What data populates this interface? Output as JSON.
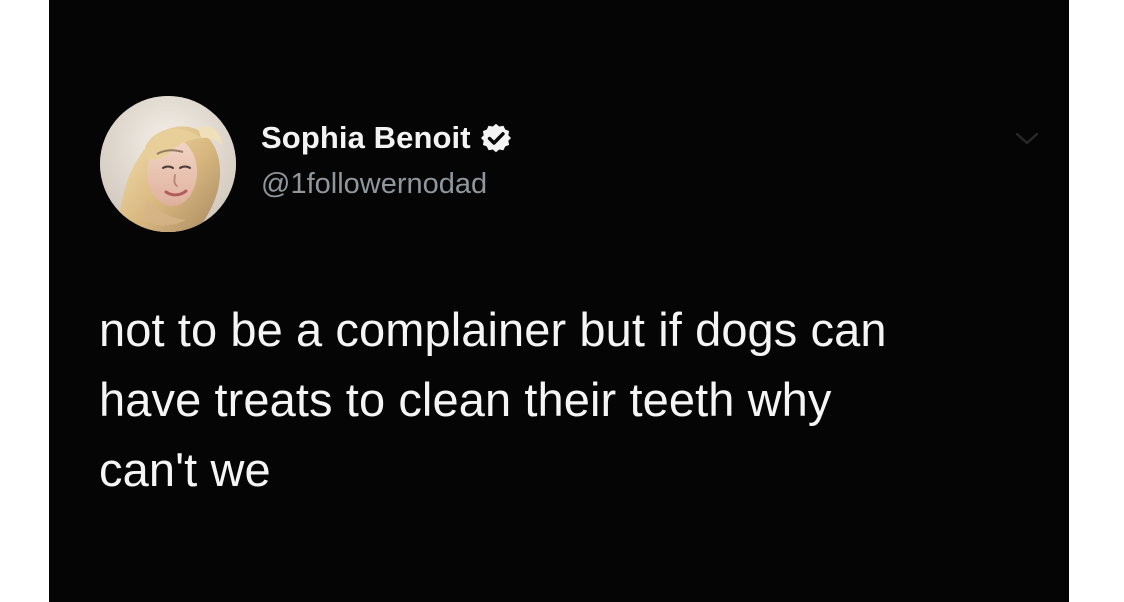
{
  "tweet": {
    "author": {
      "display_name": "Sophia Benoit",
      "handle": "@1followernodad"
    },
    "text_lines": [
      "not to be a complainer but if dogs can",
      "have treats to clean their teeth why",
      "can't we"
    ],
    "icons": {
      "verified": "verified-badge-icon",
      "menu": "chevron-down-icon"
    },
    "colors": {
      "background": "#050505",
      "name": "#f3f3f3",
      "handle": "#8f969c",
      "text": "#f5f5f5",
      "outer_background": "#ffffff"
    }
  }
}
